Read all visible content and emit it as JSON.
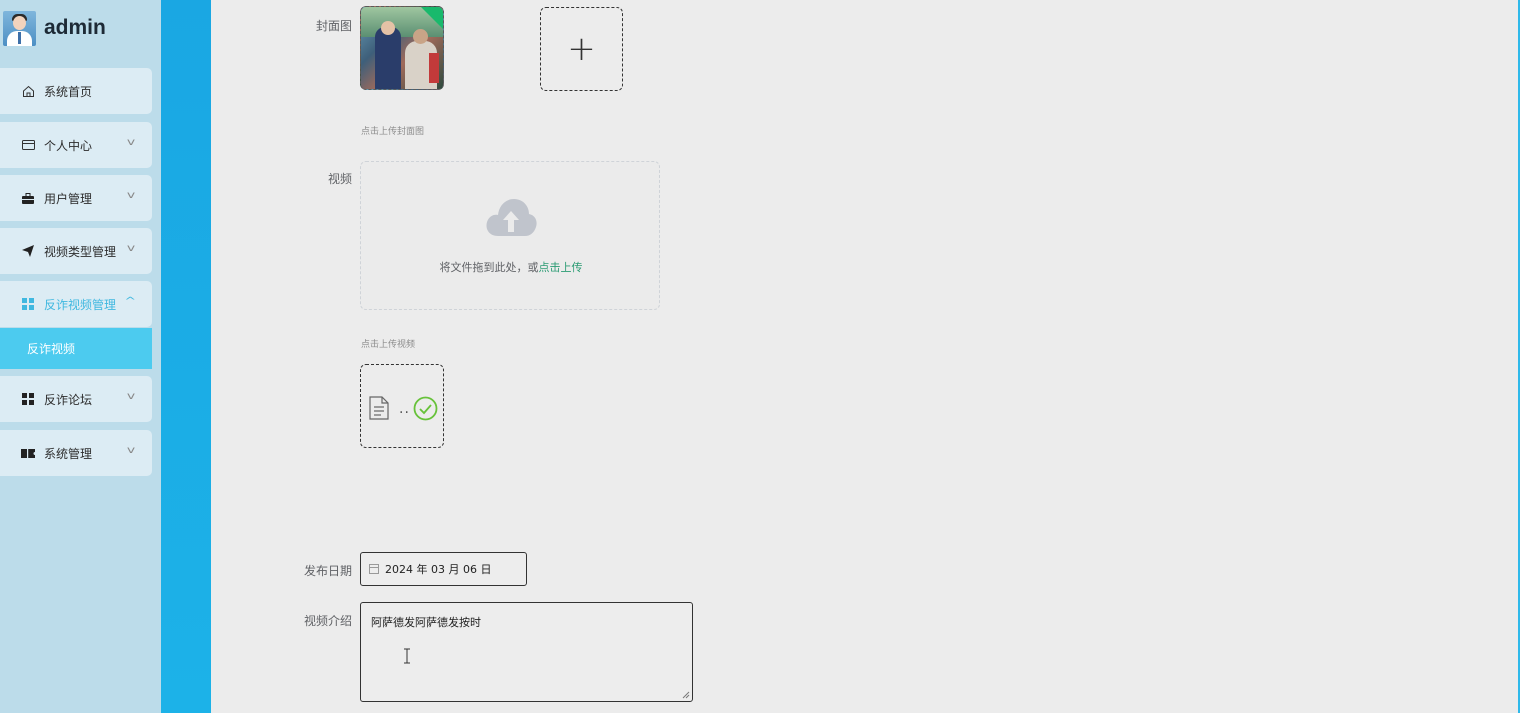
{
  "app": {
    "user_name": "admin"
  },
  "sidebar": {
    "items": [
      {
        "label": "系统首页",
        "icon": "home-icon"
      },
      {
        "label": "个人中心",
        "icon": "card-icon"
      },
      {
        "label": "用户管理",
        "icon": "briefcase-icon"
      },
      {
        "label": "视频类型管理",
        "icon": "send-icon"
      },
      {
        "label": "反诈视频管理",
        "icon": "grid-icon",
        "active": true
      },
      {
        "label": "反诈论坛",
        "icon": "grid-icon"
      },
      {
        "label": "系统管理",
        "icon": "ticket-icon"
      }
    ],
    "sub_item": {
      "label": "反诈视频"
    }
  },
  "form": {
    "cover": {
      "label": "封面图",
      "tip": "点击上传封面图"
    },
    "video": {
      "label": "视频",
      "drop_text": "将文件拖到此处，或",
      "drop_link": "点击上传",
      "tip": "点击上传视频",
      "file_dots": ".."
    },
    "publish_date": {
      "label": "发布日期",
      "value": "2024 年 03 月 06 日"
    },
    "intro": {
      "label": "视频介绍",
      "value": "阿萨德发阿萨德发按时"
    }
  },
  "colors": {
    "sidebar_bg": "#bcdcea",
    "active_accent": "#4ccbef",
    "stripe": "#1aa7e3",
    "link": "#2c9c74",
    "success": "#67c23a"
  }
}
